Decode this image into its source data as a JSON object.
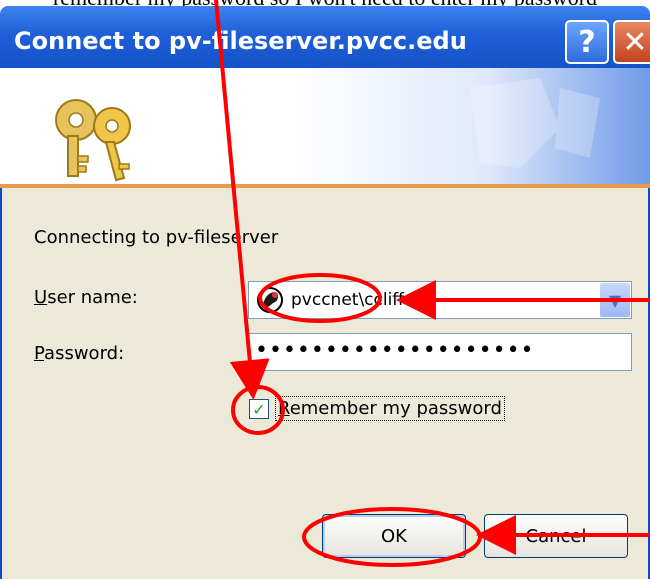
{
  "caption": "remember my password so I won't need to enter my password",
  "dialog": {
    "title": "Connect to pv-fileserver.pvcc.edu",
    "help_icon": "?",
    "close_icon": "✕",
    "connecting_text": "Connecting to pv-fileserver",
    "user_label": "User name:",
    "user_value": "pvccnet\\ccliff",
    "password_label": "Password:",
    "password_value": "••••••••••••••••••••",
    "remember_label": "Remember my password",
    "remember_checked": true,
    "ok_label": "OK",
    "cancel_label": "Cancel"
  },
  "icons": {
    "banner": "keys-icon",
    "user": "user-icon",
    "dropdown": "chevron-down-icon",
    "check": "checkmark-icon"
  },
  "colors": {
    "titlebar": "#2a63d6",
    "annotation": "#ff0000",
    "banner_stripe": "#e89b4b"
  }
}
